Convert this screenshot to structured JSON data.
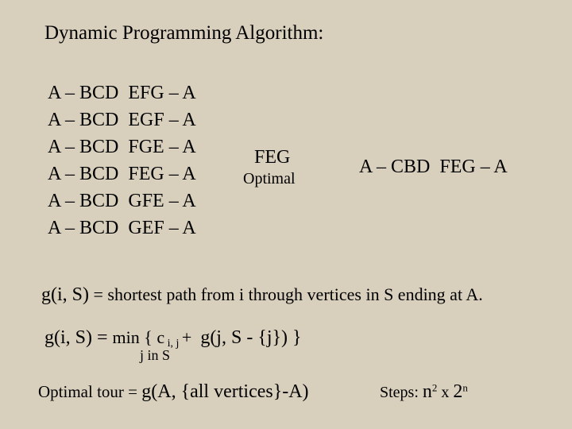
{
  "title": "Dynamic Programming Algorithm:",
  "rows": [
    {
      "left": "A – BCD",
      "right": "EFG – A"
    },
    {
      "left": "A – BCD",
      "right": "EGF – A"
    },
    {
      "left": "A – BCD",
      "right": "FGE – A"
    },
    {
      "left": "A – BCD",
      "right": "FEG – A"
    },
    {
      "left": "A – BCD",
      "right": "GFE – A"
    },
    {
      "left": "A – BCD",
      "right": "GEF – A"
    }
  ],
  "middle": {
    "top": "FEG",
    "bottom": "Optimal"
  },
  "result": "A – CBD  FEG – A",
  "g_desc": {
    "lhs": "g(i, S)",
    "eq": " = ",
    "rhs": "shortest path from i through vertices in S ending at A."
  },
  "g_def": {
    "lhs": "g(i, S) = ",
    "min": "min",
    "brace_open": " { c",
    "sub": " i, j ",
    "plus": "+  ",
    "tail": "g(j, S - {j}) }",
    "sub_line": "j in S"
  },
  "optimal": {
    "label": "Optimal tour = ",
    "expr": "g(A, {all vertices}-A)"
  },
  "steps": {
    "label": "Steps: ",
    "n": "n",
    "two": "2",
    "times": " x ",
    "base2": "2",
    "exp_n": "n"
  }
}
